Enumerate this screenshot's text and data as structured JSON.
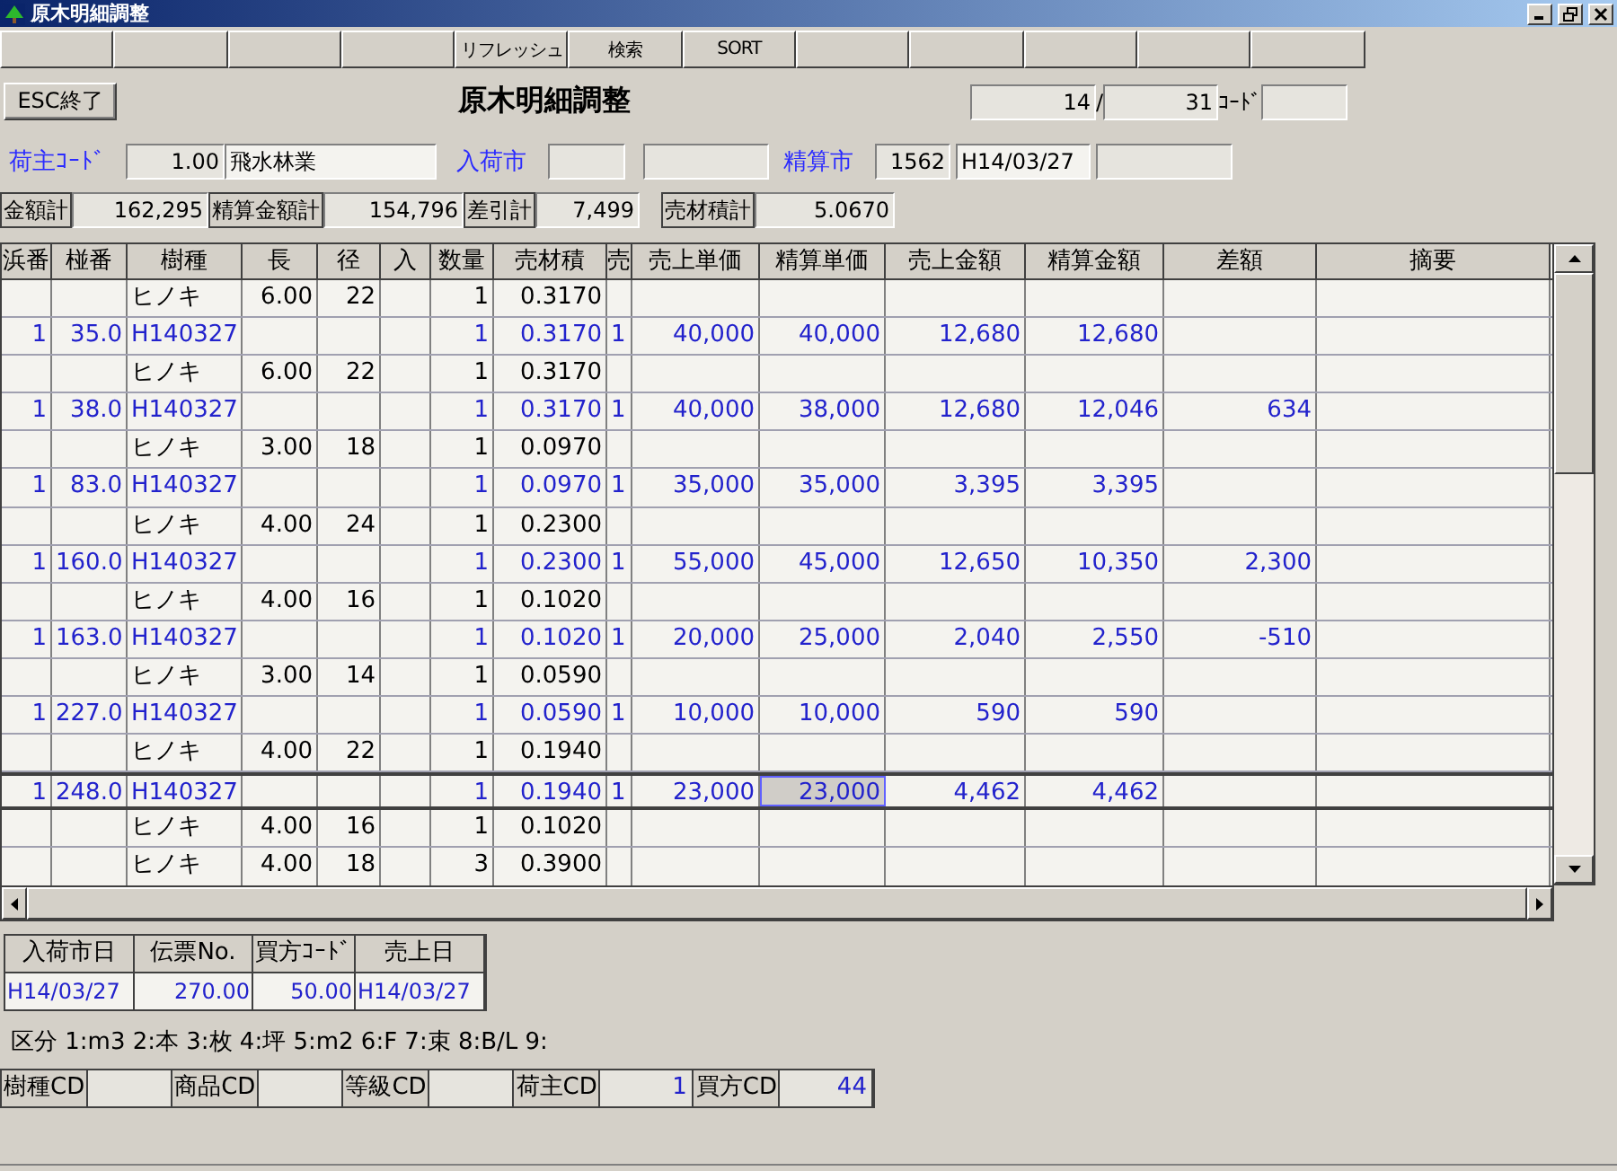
{
  "window": {
    "title": "原木明細調整"
  },
  "toolbar": {
    "buttons": [
      "リフレッシュ",
      "検索",
      "SORT"
    ]
  },
  "header": {
    "exit_button": "ESC終了",
    "title": "原木明細調整",
    "page": "14",
    "page_sep": "/",
    "total": "31",
    "code_label": "ｺｰﾄﾞ"
  },
  "shipper": {
    "label": "荷主ｺｰﾄﾞ",
    "code": "1.00",
    "name": "飛水林業"
  },
  "arrival_market": {
    "label": "入荷市"
  },
  "settlement_market": {
    "label": "精算市",
    "code": "1562",
    "date": "H14/03/27"
  },
  "totals": [
    {
      "label": "金額計",
      "value": "162,295"
    },
    {
      "label": "精算金額計",
      "value": "154,796"
    },
    {
      "label": "差引計",
      "value": "7,499"
    },
    {
      "label": "売材積計",
      "value": "5.0670"
    }
  ],
  "table": {
    "columns": [
      "浜番",
      "椪番",
      "樹種",
      "長",
      "径",
      "入",
      "数量",
      "売材積",
      "売",
      "売上単価",
      "精算単価",
      "売上金額",
      "精算金額",
      "差額",
      "摘要"
    ],
    "rows": [
      {
        "kind": "detail",
        "selected": false,
        "species": "ヒノキ",
        "length": "6.00",
        "diameter": "22",
        "qty": "1",
        "volume": "0.3170"
      },
      {
        "kind": "summary",
        "selected": false,
        "lot": "1",
        "pile": "35.0",
        "species": "H140327",
        "qty": "1",
        "volume": "0.3170",
        "sale_flag": "1",
        "sale_price": "40,000",
        "settle_price": "40,000",
        "sale_amount": "12,680",
        "settle_amount": "12,680"
      },
      {
        "kind": "detail",
        "selected": false,
        "species": "ヒノキ",
        "length": "6.00",
        "diameter": "22",
        "qty": "1",
        "volume": "0.3170"
      },
      {
        "kind": "summary",
        "selected": false,
        "lot": "1",
        "pile": "38.0",
        "species": "H140327",
        "qty": "1",
        "volume": "0.3170",
        "sale_flag": "1",
        "sale_price": "40,000",
        "settle_price": "38,000",
        "sale_amount": "12,680",
        "settle_amount": "12,046",
        "difference": "634"
      },
      {
        "kind": "detail",
        "selected": false,
        "species": "ヒノキ",
        "length": "3.00",
        "diameter": "18",
        "qty": "1",
        "volume": "0.0970"
      },
      {
        "kind": "summary",
        "selected": false,
        "lot": "1",
        "pile": "83.0",
        "species": "H140327",
        "qty": "1",
        "volume": "0.0970",
        "sale_flag": "1",
        "sale_price": "35,000",
        "settle_price": "35,000",
        "sale_amount": "3,395",
        "settle_amount": "3,395"
      },
      {
        "kind": "detail",
        "selected": false,
        "species": "ヒノキ",
        "length": "4.00",
        "diameter": "24",
        "qty": "1",
        "volume": "0.2300"
      },
      {
        "kind": "summary",
        "selected": false,
        "lot": "1",
        "pile": "160.0",
        "species": "H140327",
        "qty": "1",
        "volume": "0.2300",
        "sale_flag": "1",
        "sale_price": "55,000",
        "settle_price": "45,000",
        "sale_amount": "12,650",
        "settle_amount": "10,350",
        "difference": "2,300"
      },
      {
        "kind": "detail",
        "selected": false,
        "species": "ヒノキ",
        "length": "4.00",
        "diameter": "16",
        "qty": "1",
        "volume": "0.1020"
      },
      {
        "kind": "summary",
        "selected": false,
        "lot": "1",
        "pile": "163.0",
        "species": "H140327",
        "qty": "1",
        "volume": "0.1020",
        "sale_flag": "1",
        "sale_price": "20,000",
        "settle_price": "25,000",
        "sale_amount": "2,040",
        "settle_amount": "2,550",
        "difference": "-510"
      },
      {
        "kind": "detail",
        "selected": false,
        "species": "ヒノキ",
        "length": "3.00",
        "diameter": "14",
        "qty": "1",
        "volume": "0.0590"
      },
      {
        "kind": "summary",
        "selected": false,
        "lot": "1",
        "pile": "227.0",
        "species": "H140327",
        "qty": "1",
        "volume": "0.0590",
        "sale_flag": "1",
        "sale_price": "10,000",
        "settle_price": "10,000",
        "sale_amount": "590",
        "settle_amount": "590"
      },
      {
        "kind": "detail",
        "selected": false,
        "species": "ヒノキ",
        "length": "4.00",
        "diameter": "22",
        "qty": "1",
        "volume": "0.1940"
      },
      {
        "kind": "summary",
        "selected": true,
        "lot": "1",
        "pile": "248.0",
        "species": "H140327",
        "qty": "1",
        "volume": "0.1940",
        "sale_flag": "1",
        "sale_price": "23,000",
        "settle_price": "23,000",
        "sale_amount": "4,462",
        "settle_amount": "4,462"
      },
      {
        "kind": "detail",
        "selected": false,
        "species": "ヒノキ",
        "length": "4.00",
        "diameter": "16",
        "qty": "1",
        "volume": "0.1020"
      },
      {
        "kind": "detail",
        "selected": false,
        "species": "ヒノキ",
        "length": "4.00",
        "diameter": "18",
        "qty": "3",
        "volume": "0.3900"
      }
    ]
  },
  "slip": {
    "columns": [
      "入荷市日",
      "伝票No.",
      "買方ｺｰﾄﾞ",
      "売上日"
    ],
    "values": [
      "H14/03/27",
      "270.00",
      "50.00",
      "H14/03/27"
    ]
  },
  "legend": "区分 1:m3 2:本 3:枚 4:坪 5:m2 6:F 7:束 8:B/L 9:",
  "codes": [
    {
      "label": "樹種CD"
    },
    {
      "label": "商品CD"
    },
    {
      "label": "等級CD"
    },
    {
      "label": "荷主CD",
      "value": "1"
    },
    {
      "label": "買方CD",
      "value": "44"
    }
  ]
}
